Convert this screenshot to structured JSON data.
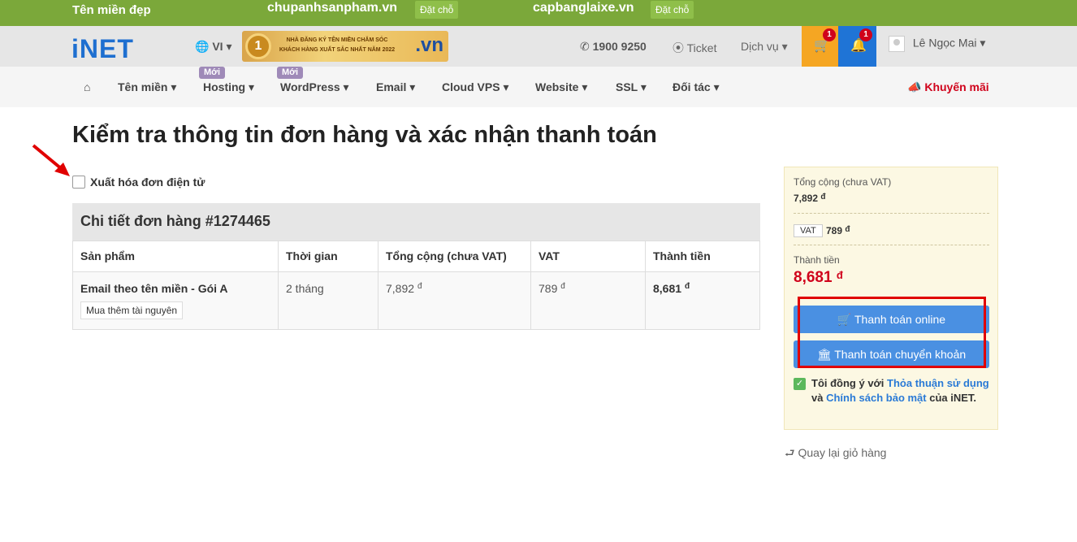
{
  "promo": {
    "title": "Tên miền đẹp",
    "domain1": "chupanhsanpham.vn",
    "reserve1": "Đặt chỗ",
    "domain2": "capbanglaixe.vn",
    "reserve2": "Đặt chỗ"
  },
  "header": {
    "logo": "iNET",
    "lang": "VI",
    "banner_line1": "NHÀ ĐĂNG KÝ TÊN MIỀN CHĂM SÓC",
    "banner_line2": "KHÁCH HÀNG XUẤT SẮC NHẤT NĂM 2022",
    "banner_rank": "1",
    "banner_vn": ".vn",
    "phone": "1900 9250",
    "ticket": "Ticket",
    "services": "Dịch vụ",
    "cart_count": "1",
    "notif_count": "1",
    "user": "Lê Ngọc Mai"
  },
  "nav": {
    "items": [
      "Tên miền",
      "Hosting",
      "WordPress",
      "Email",
      "Cloud VPS",
      "Website",
      "SSL",
      "Đối tác"
    ],
    "new_badge": "Mới",
    "promo": "Khuyến mãi"
  },
  "main": {
    "title": "Kiểm tra thông tin đơn hàng và xác nhận thanh toán",
    "invoice_label": "Xuất hóa đơn điện tử",
    "order_title": "Chi tiết đơn hàng #1274465",
    "columns": [
      "Sản phẩm",
      "Thời gian",
      "Tổng cộng (chưa VAT)",
      "VAT",
      "Thành tiền"
    ],
    "row": {
      "product": "Email theo tên miền - Gói A",
      "add_resource": "Mua thêm tài nguyên",
      "duration": "2 tháng",
      "subtotal": "7,892",
      "vat": "789",
      "total": "8,681",
      "currency": "đ"
    }
  },
  "summary": {
    "subtotal_label": "Tổng cộng (chưa VAT)",
    "subtotal": "7,892",
    "vat_label": "VAT",
    "vat": "789",
    "total_label": "Thành tiền",
    "total": "8,681",
    "currency": "đ",
    "pay_online": "Thanh toán online",
    "pay_transfer": "Thanh toán chuyển khoản",
    "agree_prefix": "Tôi đồng ý với",
    "terms": "Thỏa thuận sử dụng",
    "and": "và",
    "privacy": "Chính sách bảo mật",
    "agree_suffix": "của iNET.",
    "back": "Quay lại giỏ hàng"
  },
  "colors": {
    "promo_bar": "#7ba83a",
    "brand_blue": "#1e6fd0",
    "cart": "#f5a623",
    "bell": "#1f74d6",
    "price_red": "#d0021b",
    "button_blue": "#4a90e2",
    "highlight": "#e00000"
  }
}
